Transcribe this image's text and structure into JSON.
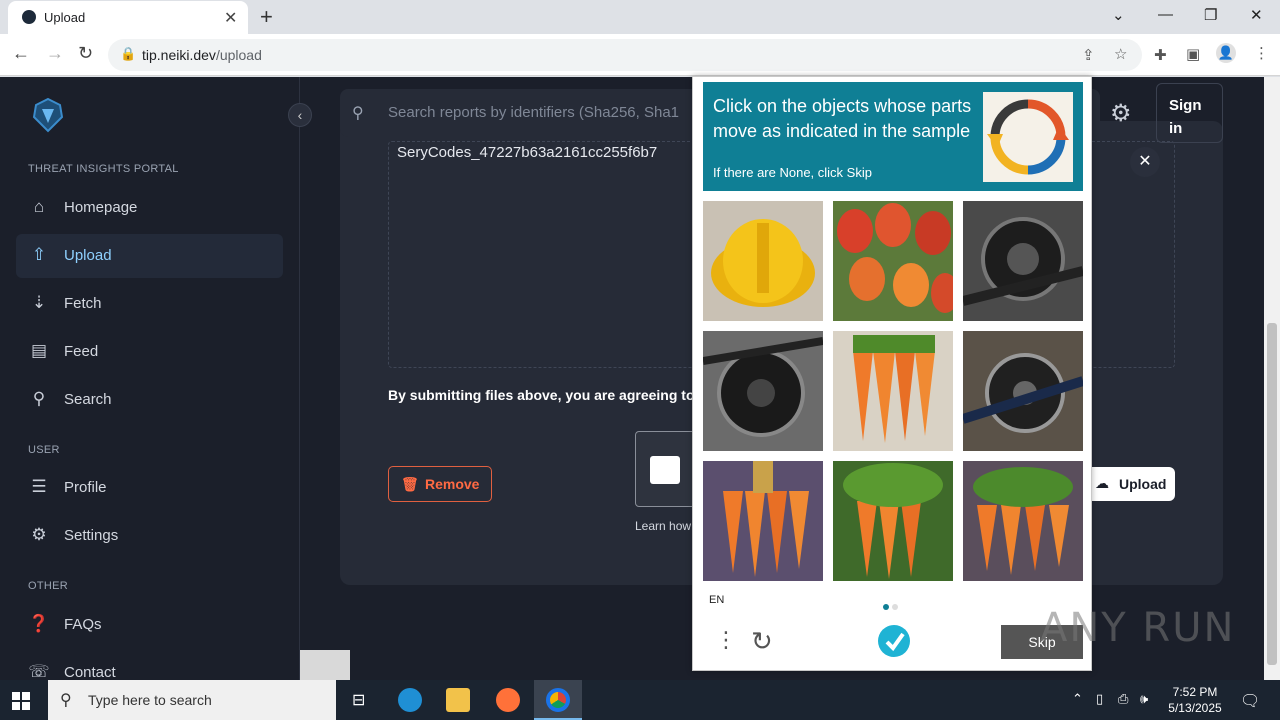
{
  "browser": {
    "tab_title": "Upload",
    "url_host": "tip.neiki.dev",
    "url_path": "/upload",
    "new_tab_label": "+"
  },
  "sidebar": {
    "section_portal": "THREAT INSIGHTS PORTAL",
    "section_user": "USER",
    "section_other": "OTHER",
    "items": [
      {
        "label": "Homepage",
        "icon": "home-icon"
      },
      {
        "label": "Upload",
        "icon": "upload-icon",
        "active": true
      },
      {
        "label": "Fetch",
        "icon": "download-icon"
      },
      {
        "label": "Feed",
        "icon": "feed-icon"
      },
      {
        "label": "Search",
        "icon": "search-icon"
      },
      {
        "label": "Profile",
        "icon": "profile-icon"
      },
      {
        "label": "Settings",
        "icon": "gear-icon"
      },
      {
        "label": "FAQs",
        "icon": "faq-icon"
      },
      {
        "label": "Contact",
        "icon": "contact-icon"
      }
    ]
  },
  "header": {
    "search_placeholder": "Search reports by identifiers (Sha256, Sha1",
    "signin_line1": "Sign",
    "signin_line2": "in"
  },
  "upload": {
    "file_name": "SeryCodes_47227b63a2161cc255f6b7",
    "agreement_text": "By submitting files above, you are agreeing to",
    "remove_label": "Remove",
    "learn_text": "Learn how",
    "upload_label": "Upload"
  },
  "captcha": {
    "prompt": "Click on the objects whose parts move as indicated in the sample",
    "sub_prompt": "If there are None, click Skip",
    "language": "EN",
    "skip_label": "Skip",
    "tiles": [
      {
        "subject": "hard hat"
      },
      {
        "subject": "tulips"
      },
      {
        "subject": "bicycle chainring"
      },
      {
        "subject": "bicycle chainring"
      },
      {
        "subject": "carrots"
      },
      {
        "subject": "bicycle chainring"
      },
      {
        "subject": "carrots"
      },
      {
        "subject": "carrots"
      },
      {
        "subject": "carrots"
      }
    ],
    "accent_color": "#0f7f95"
  },
  "watermark": "ANY RUN",
  "taskbar": {
    "search_placeholder": "Type here to search",
    "time": "7:52 PM",
    "date": "5/13/2025"
  }
}
